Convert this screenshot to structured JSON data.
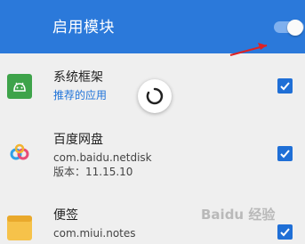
{
  "header": {
    "title": "启用模块",
    "toggle_on": true,
    "accent_color": "#2b79da"
  },
  "modules": [
    {
      "name": "系统框架",
      "subtitle": "推荐的应用",
      "subtitle_color": "#1f73d9",
      "icon": "android-icon",
      "checked": true
    },
    {
      "name": "百度网盘",
      "package": "com.baidu.netdisk",
      "version": "版本：11.15.10",
      "icon": "baidu-netdisk-icon",
      "checked": true
    },
    {
      "name": "便签",
      "package": "com.miui.notes",
      "icon": "notes-icon",
      "checked": true
    }
  ],
  "watermark": "Baidu 经验"
}
